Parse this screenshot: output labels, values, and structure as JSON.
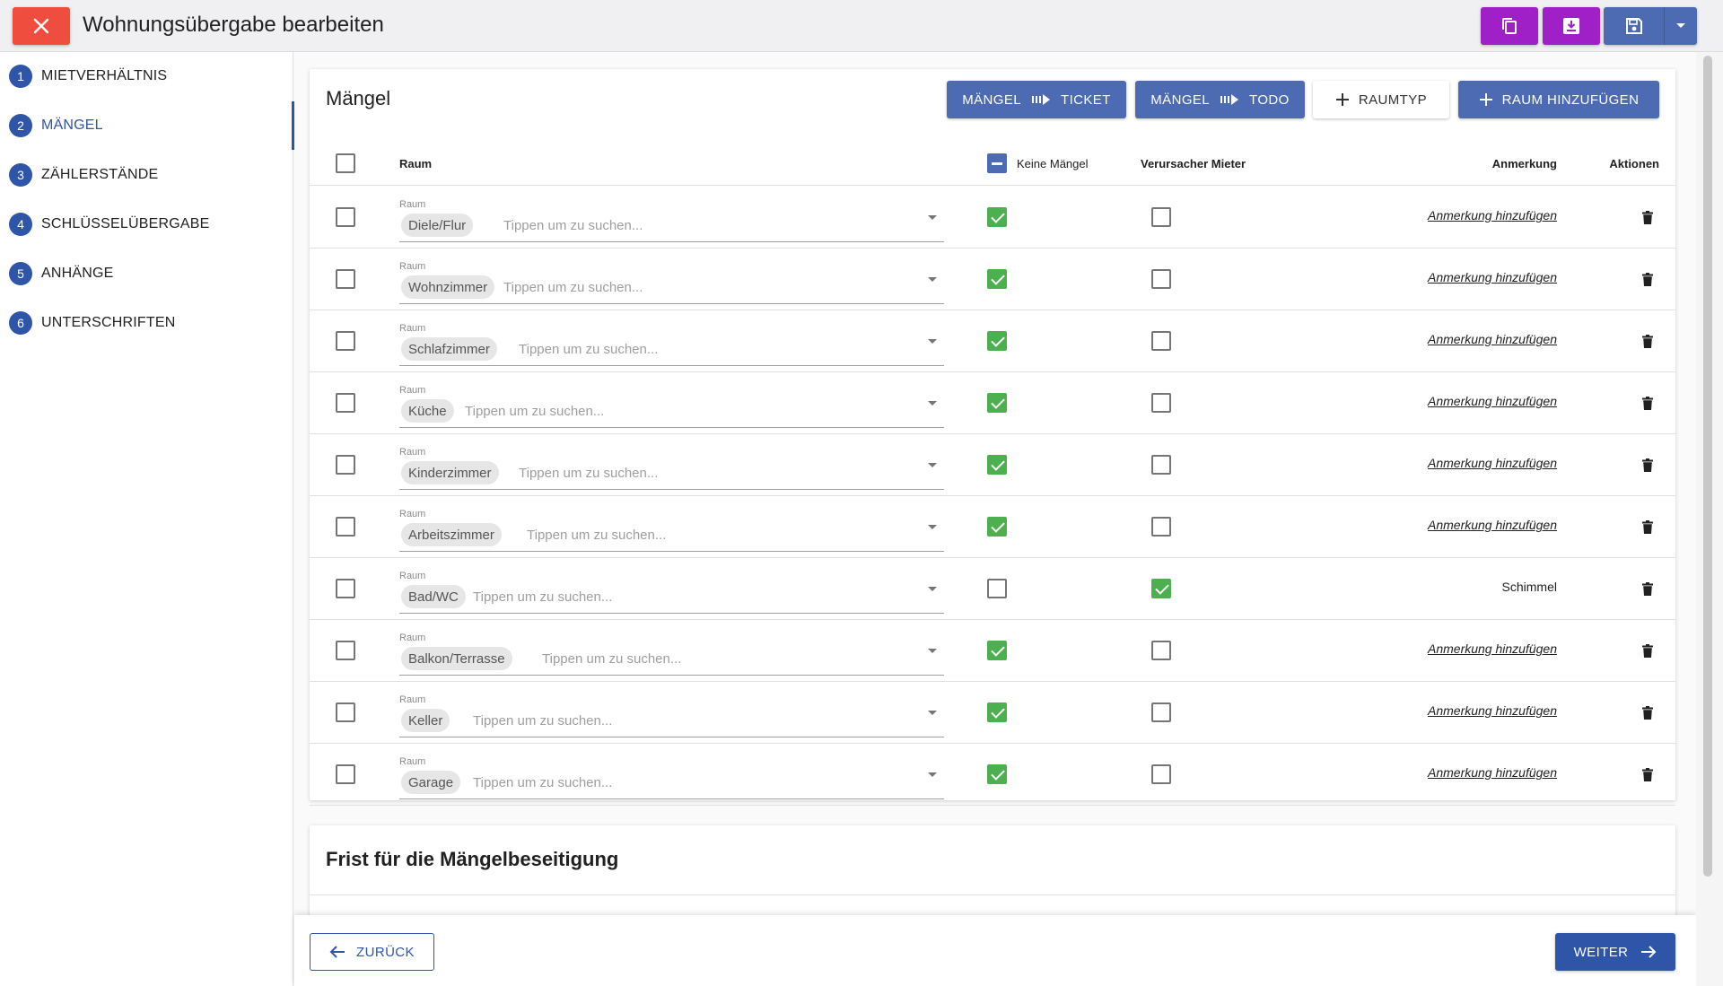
{
  "header": {
    "title": "Wohnungsübergabe bearbeiten",
    "close_icon": "close-icon",
    "copy_icon": "copy-icon",
    "download_icon": "download-icon",
    "save_icon": "save-icon",
    "dropdown_icon": "chevron-down-icon",
    "colors": {
      "close": "#ef4d3d",
      "purple": "#a020c8",
      "save": "#4d6bb3"
    }
  },
  "sidebar": {
    "steps": [
      {
        "num": "1",
        "label": "MIETVERHÄLTNIS"
      },
      {
        "num": "2",
        "label": "MÄNGEL"
      },
      {
        "num": "3",
        "label": "ZÄHLERSTÄNDE"
      },
      {
        "num": "4",
        "label": "SCHLÜSSELÜBERGABE"
      },
      {
        "num": "5",
        "label": "ANHÄNGE"
      },
      {
        "num": "6",
        "label": "UNTERSCHRIFTEN"
      }
    ],
    "active_step": "2"
  },
  "maengel": {
    "title": "Mängel",
    "buttons": {
      "to_ticket": {
        "left": "MÄNGEL",
        "right": "TICKET"
      },
      "to_todo": {
        "left": "MÄNGEL",
        "right": "TODO"
      },
      "raumtyp": "RAUMTYP",
      "add_room": "RAUM HINZUFÜGEN"
    },
    "columns": {
      "raum": "Raum",
      "keine_maengel": "Keine Mängel",
      "verursacher": "Verursacher Mieter",
      "anmerkung": "Anmerkung",
      "aktionen": "Aktionen"
    },
    "field_label": "Raum",
    "placeholder": "Tippen um zu suchen...",
    "add_note": "Anmerkung hinzufügen",
    "rows": [
      {
        "room": "Diele/Flur",
        "keine_maengel": true,
        "verursacher": false,
        "note": ""
      },
      {
        "room": "Wohnzimmer",
        "keine_maengel": true,
        "verursacher": false,
        "note": ""
      },
      {
        "room": "Schlafzimmer",
        "keine_maengel": true,
        "verursacher": false,
        "note": ""
      },
      {
        "room": "Küche",
        "keine_maengel": true,
        "verursacher": false,
        "note": ""
      },
      {
        "room": "Kinderzimmer",
        "keine_maengel": true,
        "verursacher": false,
        "note": ""
      },
      {
        "room": "Arbeitszimmer",
        "keine_maengel": true,
        "verursacher": false,
        "note": ""
      },
      {
        "room": "Bad/WC",
        "keine_maengel": false,
        "verursacher": true,
        "note": "Schimmel"
      },
      {
        "room": "Balkon/Terrasse",
        "keine_maengel": true,
        "verursacher": false,
        "note": ""
      },
      {
        "room": "Keller",
        "keine_maengel": true,
        "verursacher": false,
        "note": ""
      },
      {
        "room": "Garage",
        "keine_maengel": true,
        "verursacher": false,
        "note": ""
      }
    ]
  },
  "frist": {
    "title": "Frist für die Mängelbeseitigung"
  },
  "footer": {
    "back": "ZURÜCK",
    "next": "WEITER"
  },
  "colors": {
    "primary": "#2f55a8",
    "button_blue": "#4d6bb3",
    "check_green": "#4caf50"
  }
}
